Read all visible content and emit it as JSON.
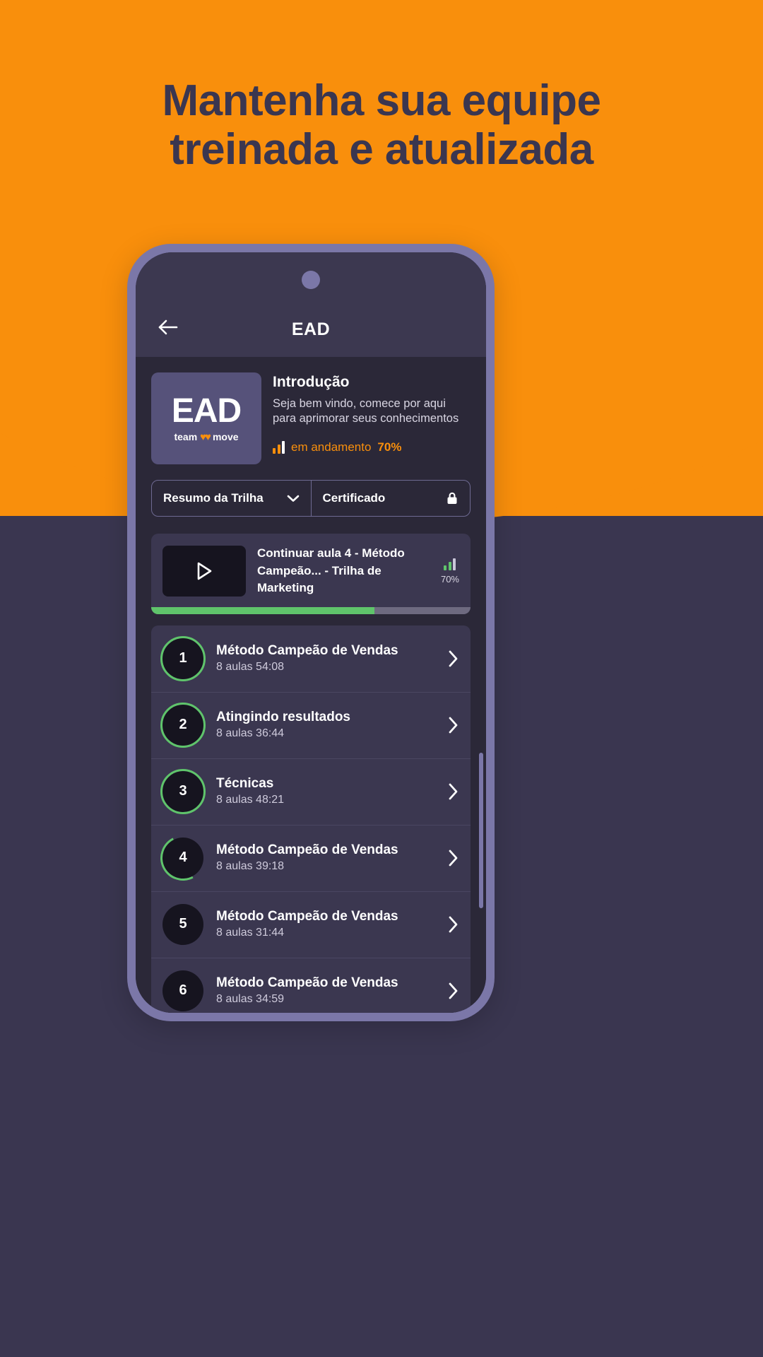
{
  "theme": {
    "orange": "#F98F0C",
    "dark_purple": "#3A3650",
    "app_bg": "#2B2838",
    "card_bg": "#3B3750",
    "green": "#5FC46B",
    "bezel": "#7B77A8"
  },
  "headline": {
    "line1": "Mantenha sua equipe",
    "line2": "treinada e atualizada"
  },
  "app": {
    "header": {
      "back_icon": "arrow-left-icon",
      "title": "EAD"
    },
    "course": {
      "logo": {
        "main": "EAD",
        "team": "team",
        "mark": "♥♥",
        "move": "move"
      },
      "title": "Introdução",
      "description": "Seja bem vindo, comece por aqui para aprimorar seus conhecimentos",
      "status_icon": "bar-chart-icon",
      "status_label": "em andamento",
      "status_percent": "70%"
    },
    "tabs": [
      {
        "label": "Resumo da Trilha",
        "icon": "chevron-down-icon"
      },
      {
        "label": "Certificado",
        "icon": "lock-icon"
      }
    ],
    "continue": {
      "play_icon": "play-icon",
      "line1": "Continuar aula 4 - Método",
      "line2": "Campeão... - Trilha de Marketing",
      "progress_icon": "bar-chart-icon",
      "percent": "70%",
      "progress_value": 70
    },
    "modules": [
      {
        "number": "1",
        "title": "Método Campeão de Vendas",
        "meta": "8 aulas 54:08",
        "ring": "full",
        "chevron": "chevron-right-icon"
      },
      {
        "number": "2",
        "title": "Atingindo resultados",
        "meta": "8 aulas 36:44",
        "ring": "full",
        "chevron": "chevron-right-icon"
      },
      {
        "number": "3",
        "title": "Técnicas",
        "meta": "8 aulas 48:21",
        "ring": "full",
        "chevron": "chevron-right-icon"
      },
      {
        "number": "4",
        "title": "Método Campeão de Vendas",
        "meta": "8 aulas 39:18",
        "ring": "part",
        "chevron": "chevron-right-icon"
      },
      {
        "number": "5",
        "title": "Método Campeão de Vendas",
        "meta": "8 aulas 31:44",
        "ring": "none",
        "chevron": "chevron-right-icon"
      },
      {
        "number": "6",
        "title": "Método Campeão de Vendas",
        "meta": "8 aulas 34:59",
        "ring": "none",
        "chevron": "chevron-right-icon"
      }
    ]
  }
}
